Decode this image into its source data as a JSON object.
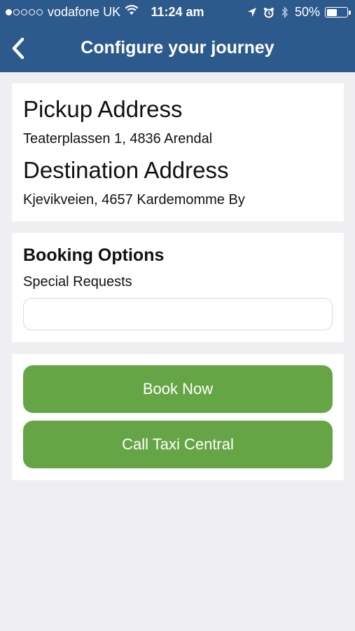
{
  "status_bar": {
    "signal_dots_filled": 1,
    "signal_dots_total": 5,
    "carrier": "vodafone UK",
    "time": "11:24 am",
    "battery_percent_label": "50%",
    "battery_level": 0.5
  },
  "nav": {
    "back_icon": "chevron-left-icon",
    "title": "Configure your journey"
  },
  "addresses": {
    "pickup_heading": "Pickup Address",
    "pickup_value": "Teaterplassen 1, 4836 Arendal",
    "destination_heading": "Destination Address",
    "destination_value": "Kjevikveien, 4657 Kardemomme By"
  },
  "booking_options": {
    "title": "Booking Options",
    "special_requests_label": "Special Requests",
    "special_requests_value": ""
  },
  "actions": {
    "book_now_label": "Book Now",
    "call_taxi_label": "Call Taxi Central"
  },
  "colors": {
    "header_blue": "#2d5a8c",
    "button_green": "#66a546",
    "background": "#efeff1"
  }
}
